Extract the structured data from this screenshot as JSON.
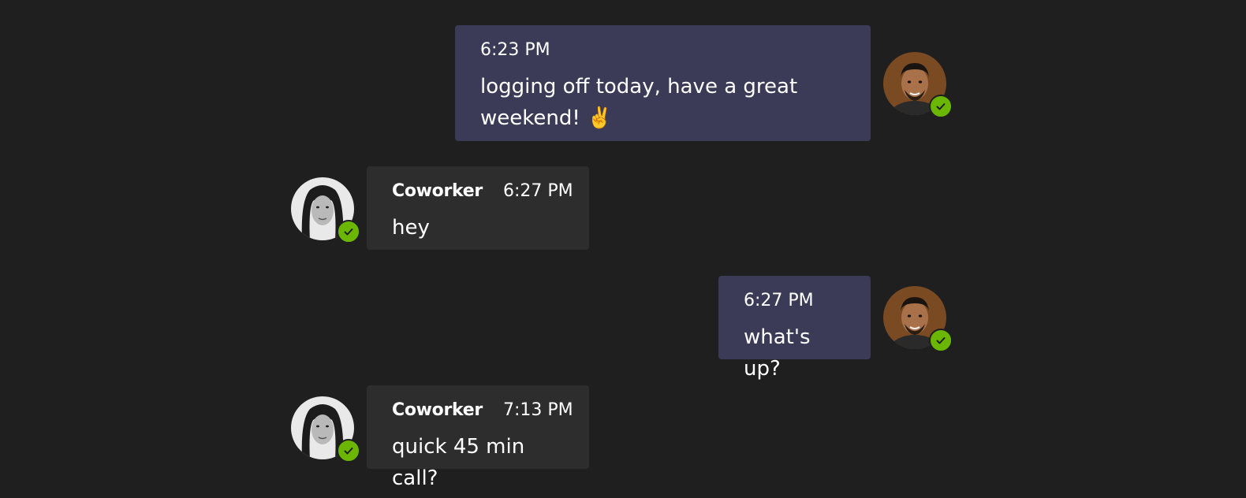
{
  "colors": {
    "background": "#1f1f1f",
    "my_bubble": "#3b3b57",
    "their_bubble": "#2d2d2d",
    "presence_available": "#6bb700"
  },
  "messages": [
    {
      "from": "me",
      "time": "6:23 PM",
      "text_line1": "logging off today, have a great",
      "text_line2": "weekend! ✌️",
      "avatar_icon": "user-avatar-icon",
      "presence_icon": "available-check-icon"
    },
    {
      "from": "them",
      "sender": "Coworker",
      "time": "6:27 PM",
      "text": "hey",
      "avatar_icon": "coworker-avatar-icon",
      "presence_icon": "available-check-icon"
    },
    {
      "from": "me",
      "time": "6:27 PM",
      "text": "what's up?",
      "avatar_icon": "user-avatar-icon",
      "presence_icon": "available-check-icon"
    },
    {
      "from": "them",
      "sender": "Coworker",
      "time": "7:13 PM",
      "text": "quick 45 min call?",
      "avatar_icon": "coworker-avatar-icon",
      "presence_icon": "available-check-icon"
    }
  ]
}
